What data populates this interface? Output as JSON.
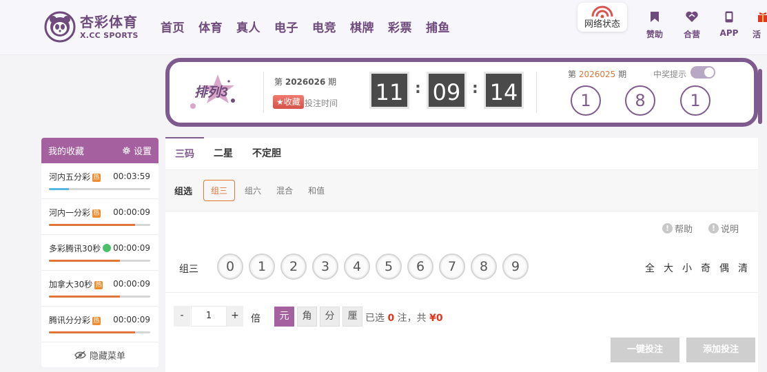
{
  "brand": {
    "name_cn": "杏彩体育",
    "name_en": "X.CC SPORTS"
  },
  "nav": [
    "首页",
    "体育",
    "真人",
    "电子",
    "电竞",
    "棋牌",
    "彩票",
    "捕鱼"
  ],
  "network": {
    "label": "网络状态",
    "icon": "signal-icon"
  },
  "quick_links": [
    {
      "label": "赞助",
      "icon": "bookmark-icon"
    },
    {
      "label": "合营",
      "icon": "handshake-icon"
    },
    {
      "label": "APP",
      "icon": "phone-icon"
    },
    {
      "label": "活",
      "icon": "gift-icon"
    }
  ],
  "lottery": {
    "logo_text": "排列3",
    "current_prefix": "第",
    "current_issue": "2026026",
    "current_suffix": "期",
    "favorite_label": "收藏",
    "deadline_label": "投注时间",
    "countdown": [
      "11",
      "09",
      "14"
    ],
    "last_prefix": "第",
    "last_issue": "2026025",
    "last_suffix": "期",
    "win_hint_label": "中奖提示",
    "win_hint_on": true,
    "results": [
      "1",
      "8",
      "1"
    ]
  },
  "favorites": {
    "title": "我的收藏",
    "settings_label": "设置",
    "items": [
      {
        "name": "河内五分彩",
        "tag": "热",
        "time": "00:03:59",
        "progress": 0.2,
        "color": "#58b6e0"
      },
      {
        "name": "河内一分彩",
        "tag": "热",
        "time": "00:00:09",
        "progress": 0.85,
        "color": "#e0753a"
      },
      {
        "name": "多彩腾讯30秒",
        "tag": "new",
        "time": "00:00:09",
        "progress": 0.7,
        "color": "#e0753a"
      },
      {
        "name": "加拿大30秒",
        "tag": "热",
        "time": "00:00:09",
        "progress": 0.7,
        "color": "#e0753a"
      },
      {
        "name": "腾讯分分彩",
        "tag": "热",
        "time": "00:00:09",
        "progress": 0.85,
        "color": "#e0753a"
      }
    ],
    "hide_menu_label": "隐藏菜单"
  },
  "bet": {
    "tabs": [
      "三码",
      "二星",
      "不定胆"
    ],
    "sub_label": "组选",
    "sub_items": [
      "组三",
      "组六",
      "混合",
      "和值"
    ],
    "help_label": "帮助",
    "explain_label": "说明",
    "row_label": "组三",
    "balls": [
      "0",
      "1",
      "2",
      "3",
      "4",
      "5",
      "6",
      "7",
      "8",
      "9"
    ],
    "quick_picks": [
      "全",
      "大",
      "小",
      "奇",
      "偶",
      "清"
    ],
    "minus": "-",
    "plus": "+",
    "multiplier": "1",
    "multiplier_label": "倍",
    "units": [
      "元",
      "角",
      "分",
      "厘"
    ],
    "selected_prefix": "已选",
    "selected_count": "0",
    "selected_mid": "注，共",
    "amount": "¥0",
    "one_click_label": "一键投注",
    "add_label": "添加投注"
  }
}
